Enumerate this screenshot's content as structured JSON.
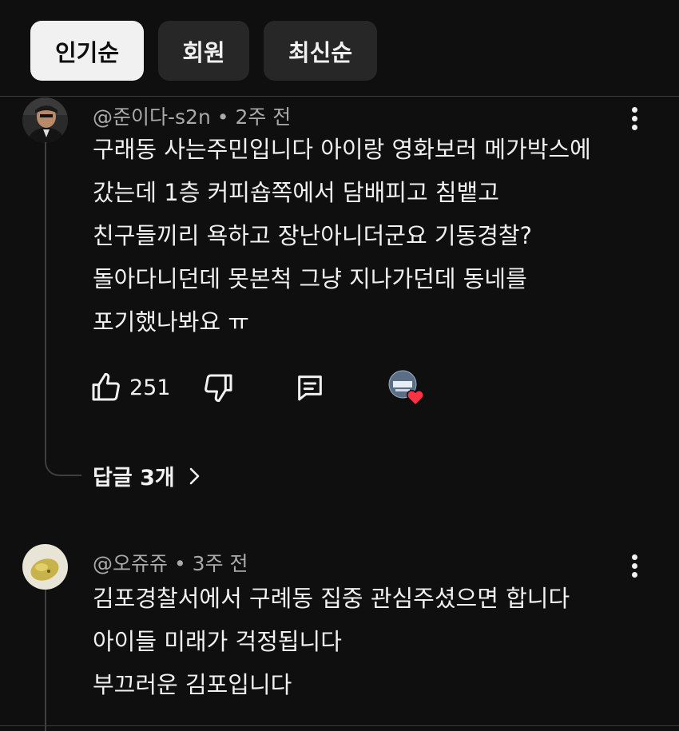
{
  "sort_chips": [
    {
      "label": "인기순",
      "active": true
    },
    {
      "label": "회원",
      "active": false
    },
    {
      "label": "최신순",
      "active": false
    }
  ],
  "comments": [
    {
      "author": "@준이다-s2n",
      "time": "2주 전",
      "lines": [
        "구래동 사는주민입니다 아이랑 영화보러 메가박스에",
        "갔는데 1층 커피숍쪽에서 담배피고 침뱉고",
        "친구들끼리 욕하고 장난아니더군요 기동경찰?",
        "돌아다니던데 못본척 그냥 지나가던데 동네를",
        "포기했나봐요 ㅠ"
      ],
      "likes": "251",
      "replies_label": "답글 3개"
    },
    {
      "author": "@오쥬쥬",
      "time": "3주 전",
      "lines": [
        "김포경찰서에서 구례동 집중 관심주셨으면 합니다",
        "아이들 미래가 걱정됩니다",
        "부끄러운 김포입니다"
      ]
    }
  ],
  "meta_separator": "•",
  "colors": {
    "background": "#0f0f0f",
    "chip": "#272727",
    "chip_active": "#f1f1f1",
    "meta_text": "#aaaaaa",
    "heart": "#ff3344"
  }
}
